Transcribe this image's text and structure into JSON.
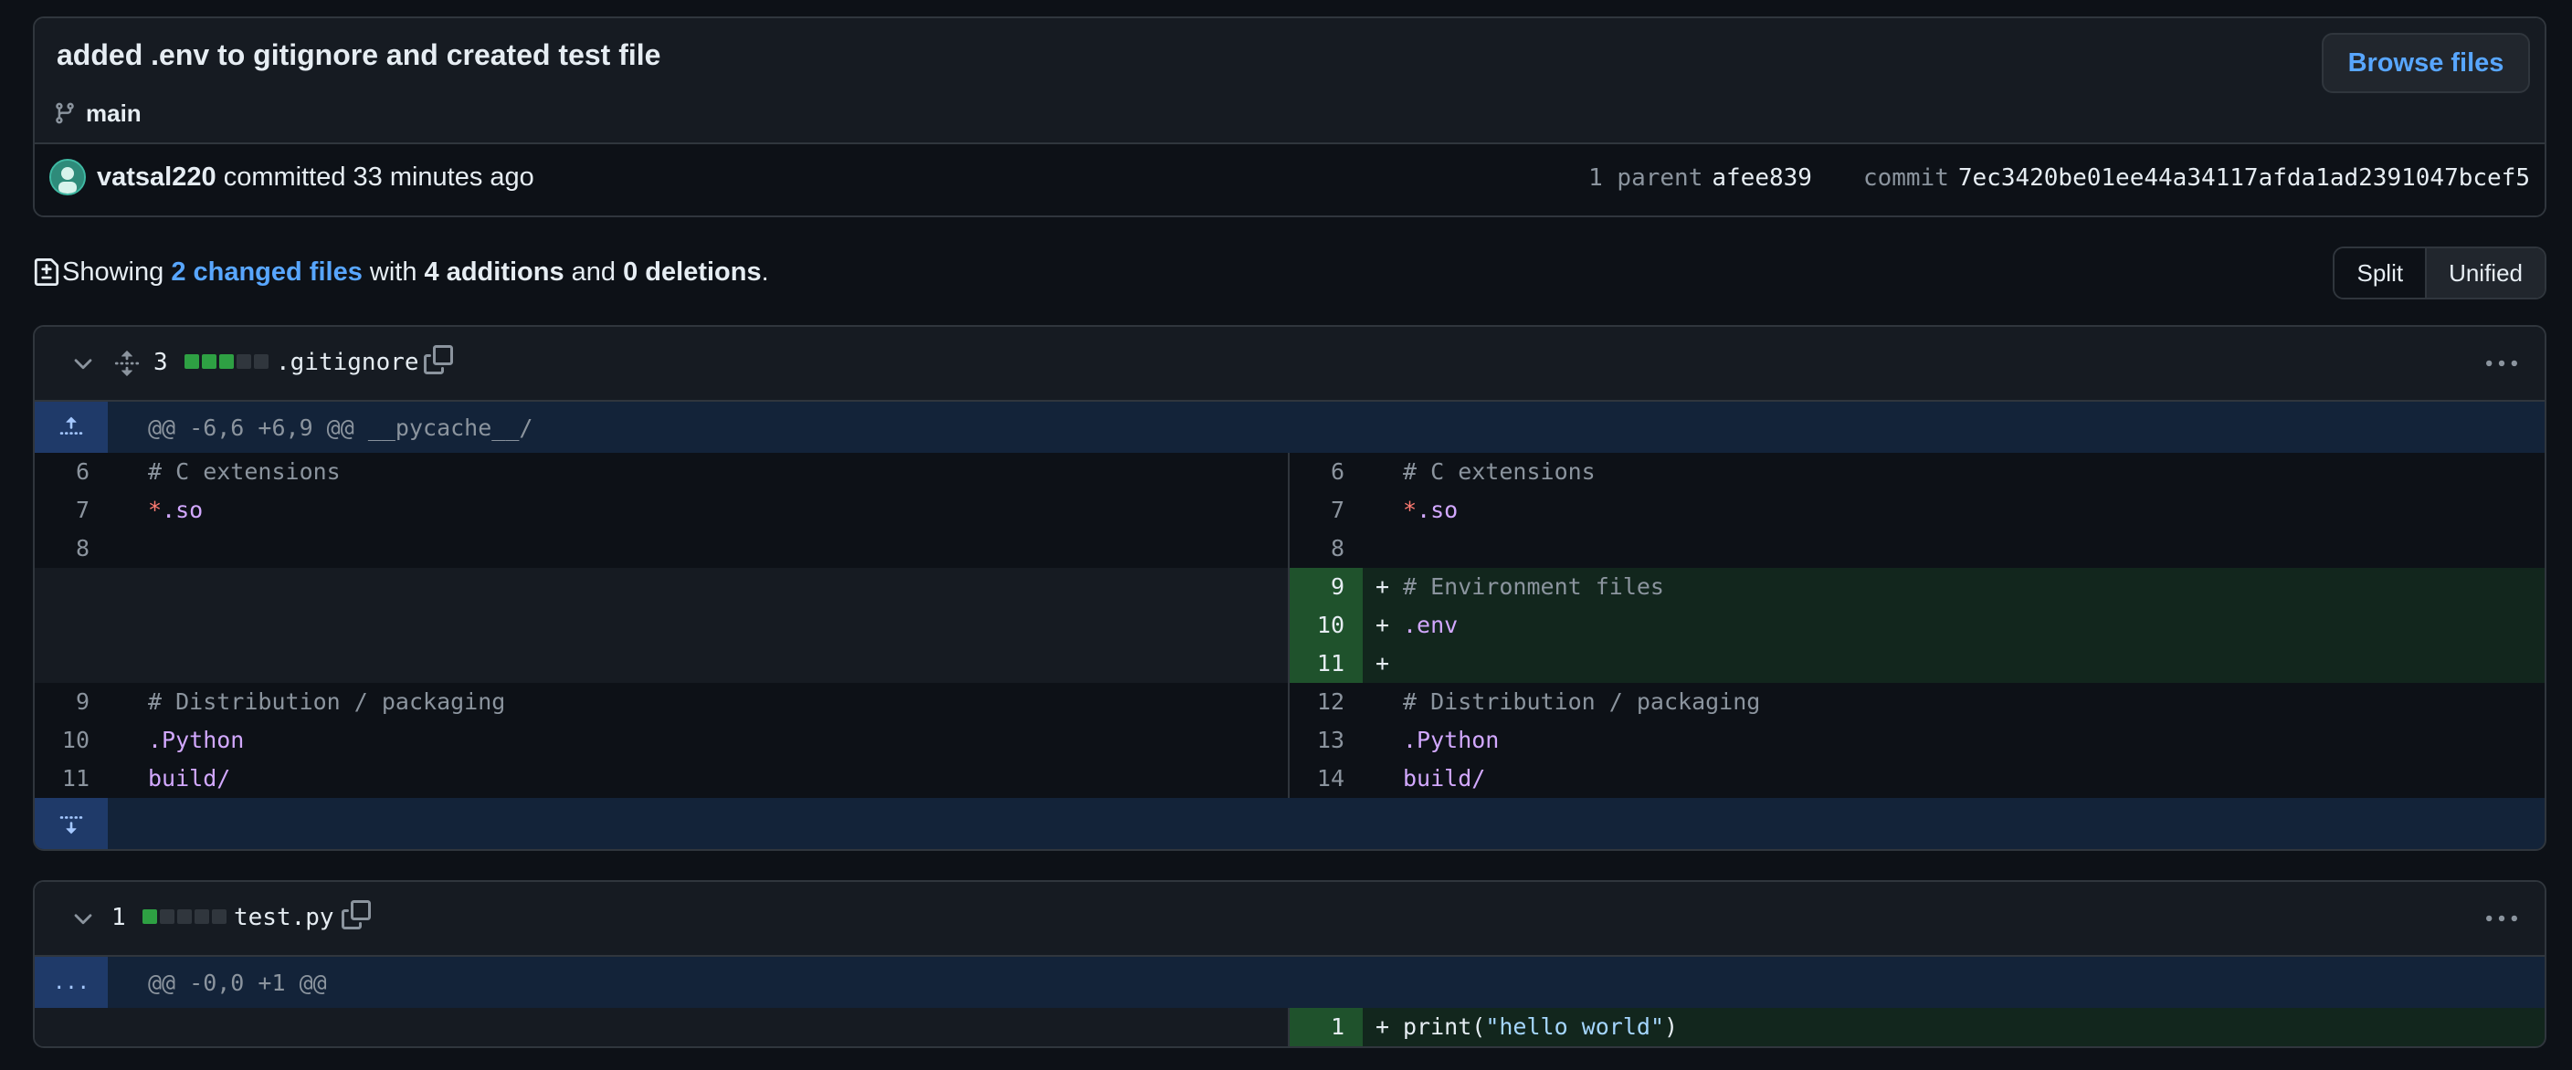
{
  "commit": {
    "title": "added .env to gitignore and created test file",
    "branch": "main",
    "browse_label": "Browse files",
    "author": "vatsal220",
    "action": "committed 33 minutes ago",
    "parent_label": "1 parent",
    "parent_hash": "afee839",
    "commit_label": "commit",
    "commit_hash": "7ec3420be01ee44a34117afda1ad2391047bcef5"
  },
  "summary": {
    "prefix": "Showing",
    "files_link": "2 changed files",
    "with": "with",
    "additions": "4 additions",
    "and": "and",
    "deletions": "0 deletions",
    "period": ".",
    "split_label": "Split",
    "unified_label": "Unified"
  },
  "files": [
    {
      "count": "3",
      "boxes": [
        "add",
        "add",
        "add",
        "neutral",
        "neutral"
      ],
      "name": ".gitignore",
      "hunk": "@@ -6,6 +6,9 @@ __pycache__/",
      "rows": [
        {
          "l_num": "6",
          "l_code": "# C extensions",
          "l_type": "comment",
          "r_num": "6",
          "r_code": "# C extensions",
          "r_type": "comment",
          "kind": "context"
        },
        {
          "l_num": "7",
          "l_code": "*.so",
          "l_type": "star",
          "r_num": "7",
          "r_code": "*.so",
          "r_type": "star",
          "kind": "context"
        },
        {
          "l_num": "8",
          "l_code": "",
          "l_type": "plain",
          "r_num": "8",
          "r_code": "",
          "r_type": "plain",
          "kind": "context"
        },
        {
          "l_num": "",
          "l_code": "",
          "l_type": "plain",
          "r_num": "9",
          "r_code": "# Environment files",
          "r_type": "comment",
          "kind": "added"
        },
        {
          "l_num": "",
          "l_code": "",
          "l_type": "plain",
          "r_num": "10",
          "r_code": ".env",
          "r_type": "purple",
          "kind": "added"
        },
        {
          "l_num": "",
          "l_code": "",
          "l_type": "plain",
          "r_num": "11",
          "r_code": "",
          "r_type": "plain",
          "kind": "added"
        },
        {
          "l_num": "9",
          "l_code": "# Distribution / packaging",
          "l_type": "comment",
          "r_num": "12",
          "r_code": "# Distribution / packaging",
          "r_type": "comment",
          "kind": "context"
        },
        {
          "l_num": "10",
          "l_code": ".Python",
          "l_type": "purple",
          "r_num": "13",
          "r_code": ".Python",
          "r_type": "purple",
          "kind": "context"
        },
        {
          "l_num": "11",
          "l_code": "build/",
          "l_type": "purple",
          "r_num": "14",
          "r_code": "build/",
          "r_type": "purple",
          "kind": "context"
        }
      ]
    },
    {
      "count": "1",
      "boxes": [
        "add",
        "neutral",
        "neutral",
        "neutral",
        "neutral"
      ],
      "name": "test.py",
      "hunk": "@@ -0,0 +1 @@",
      "hunk_gutter": "...",
      "rows": [
        {
          "l_num": "",
          "l_code": "",
          "l_type": "plain",
          "r_num": "1",
          "r_code": "print(\"hello world\")",
          "r_type": "print",
          "kind": "added"
        }
      ]
    }
  ],
  "colors": {
    "background": "#0d1117",
    "accent": "#58a6ff",
    "added": "#2ea043",
    "border": "#30363d"
  }
}
